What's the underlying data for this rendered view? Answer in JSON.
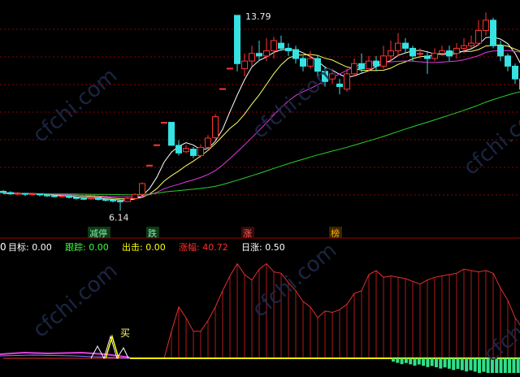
{
  "watermark": "cfchi.com",
  "main": {
    "price_high_label": "13.79",
    "price_low_label": "6.14",
    "markers": [
      {
        "text": "减停",
        "color": "#7cf0a8",
        "bg": "#0f3a18"
      },
      {
        "text": "跌",
        "color": "#7cf0a8",
        "bg": "#0f3a18"
      },
      {
        "text": "涨",
        "color": "#ff6060",
        "bg": "#3a0a0a"
      },
      {
        "text": "榜",
        "color": "#ffb000",
        "bg": "#3a2400"
      }
    ]
  },
  "indicator": {
    "prefix": "0",
    "items": [
      {
        "label": "目标",
        "value": "0.00",
        "color": "#ffffff"
      },
      {
        "label": "跟踪",
        "value": "0.00",
        "color": "#3cff3c"
      },
      {
        "label": "出击",
        "value": "0.00",
        "color": "#ffff00"
      },
      {
        "label": "涨幅",
        "value": "40.72",
        "color": "#ff3030"
      },
      {
        "label": "日涨",
        "value": "0.50",
        "color": "#ffffff"
      }
    ],
    "buy_label": "买"
  },
  "colors": {
    "up": "#ff3333",
    "down": "#36e2e2",
    "ma5": "#ffffff",
    "ma10": "#ffff66",
    "ma20": "#e03ce0",
    "ma60": "#2bd02b",
    "grid": "#8b0000"
  },
  "chart_data": {
    "type": "candlestick",
    "title": "",
    "ylim": [
      5.8,
      14.2
    ],
    "candles": [
      [
        6.9,
        6.85,
        6.95,
        6.8
      ],
      [
        6.85,
        6.8,
        6.9,
        6.75
      ],
      [
        6.8,
        6.82,
        6.86,
        6.74
      ],
      [
        6.82,
        6.78,
        6.84,
        6.72
      ],
      [
        6.78,
        6.8,
        6.84,
        6.74
      ],
      [
        6.8,
        6.76,
        6.82,
        6.7
      ],
      [
        6.76,
        6.72,
        6.78,
        6.68
      ],
      [
        6.72,
        6.7,
        6.76,
        6.66
      ],
      [
        6.7,
        6.72,
        6.75,
        6.66
      ],
      [
        6.72,
        6.66,
        6.74,
        6.62
      ],
      [
        6.66,
        6.62,
        6.68,
        6.58
      ],
      [
        6.62,
        6.6,
        6.66,
        6.55
      ],
      [
        6.6,
        6.64,
        6.68,
        6.56
      ],
      [
        6.64,
        6.58,
        6.66,
        6.54
      ],
      [
        6.58,
        6.56,
        6.62,
        6.5
      ],
      [
        6.56,
        6.52,
        6.58,
        6.46
      ],
      [
        6.52,
        6.5,
        6.55,
        6.14
      ],
      [
        6.5,
        6.62,
        6.66,
        6.48
      ],
      [
        6.62,
        6.78,
        6.82,
        6.58
      ],
      [
        6.78,
        7.2,
        7.25,
        6.74
      ],
      [
        7.9,
        7.92,
        7.94,
        7.88
      ],
      [
        8.7,
        8.72,
        8.74,
        8.68
      ],
      [
        9.58,
        9.6,
        9.62,
        9.56
      ],
      [
        9.6,
        8.7,
        9.6,
        8.68
      ],
      [
        8.7,
        8.4,
        8.9,
        8.3
      ],
      [
        8.45,
        8.58,
        8.72,
        8.4
      ],
      [
        8.55,
        8.3,
        8.64,
        8.2
      ],
      [
        8.3,
        8.62,
        8.74,
        8.22
      ],
      [
        8.62,
        8.98,
        9.1,
        8.55
      ],
      [
        9.0,
        9.82,
        9.92,
        8.9
      ],
      [
        10.9,
        10.92,
        10.94,
        10.88
      ],
      [
        11.7,
        11.72,
        11.74,
        11.68
      ],
      [
        13.79,
        11.9,
        13.79,
        11.6
      ],
      [
        11.7,
        12.0,
        12.3,
        11.4
      ],
      [
        12.0,
        12.3,
        12.6,
        11.8
      ],
      [
        12.3,
        12.2,
        12.8,
        12.0
      ],
      [
        12.2,
        12.4,
        12.9,
        12.0
      ],
      [
        12.4,
        12.8,
        12.95,
        12.1
      ],
      [
        12.7,
        12.5,
        13.0,
        12.4
      ],
      [
        12.5,
        12.4,
        12.7,
        12.2
      ],
      [
        12.45,
        12.1,
        12.6,
        11.9
      ],
      [
        12.1,
        11.8,
        12.2,
        11.6
      ],
      [
        11.8,
        12.1,
        12.4,
        11.7
      ],
      [
        12.1,
        11.6,
        12.2,
        11.4
      ],
      [
        11.6,
        11.2,
        11.8,
        11.0
      ],
      [
        11.3,
        11.5,
        11.7,
        11.1
      ],
      [
        11.1,
        11.0,
        11.3,
        10.7
      ],
      [
        10.9,
        11.5,
        11.7,
        10.8
      ],
      [
        11.5,
        11.9,
        12.1,
        11.4
      ],
      [
        11.9,
        11.7,
        12.3,
        11.5
      ],
      [
        11.7,
        12.0,
        12.2,
        11.6
      ],
      [
        12.0,
        11.8,
        12.2,
        11.6
      ],
      [
        11.8,
        12.2,
        12.6,
        11.7
      ],
      [
        12.2,
        12.4,
        12.8,
        12.0
      ],
      [
        12.4,
        12.7,
        13.1,
        12.2
      ],
      [
        12.7,
        12.5,
        12.9,
        12.3
      ],
      [
        12.5,
        12.2,
        12.6,
        12.0
      ],
      [
        12.3,
        12.3,
        12.5,
        12.1
      ],
      [
        12.2,
        12.1,
        12.4,
        11.5
      ],
      [
        12.1,
        12.3,
        12.5,
        12.0
      ],
      [
        12.3,
        12.4,
        12.6,
        12.2
      ],
      [
        12.4,
        12.2,
        12.6,
        12.0
      ],
      [
        12.3,
        12.5,
        12.7,
        12.1
      ],
      [
        12.5,
        12.6,
        12.9,
        12.3
      ],
      [
        12.6,
        12.7,
        13.0,
        12.5
      ],
      [
        12.7,
        13.2,
        13.6,
        12.6
      ],
      [
        13.2,
        13.6,
        13.9,
        13.0
      ],
      [
        13.6,
        12.6,
        13.7,
        12.5
      ],
      [
        12.6,
        12.2,
        12.8,
        12.0
      ],
      [
        12.2,
        11.8,
        12.3,
        11.6
      ],
      [
        11.8,
        11.3,
        11.9,
        11.1
      ],
      [
        11.3,
        10.9,
        11.4,
        10.7
      ]
    ],
    "indicator_line": [
      0,
      0,
      0,
      0,
      0,
      0,
      0,
      0,
      0,
      0,
      0,
      0,
      0,
      0,
      0,
      0,
      0,
      0,
      0,
      0,
      0,
      0,
      0,
      2.0,
      3.8,
      3.0,
      2.0,
      2.0,
      2.8,
      3.8,
      5.0,
      6.1,
      7.0,
      6.2,
      5.8,
      6.6,
      7.0,
      6.4,
      6.3,
      5.6,
      5.0,
      4.2,
      3.8,
      3.0,
      3.5,
      3.4,
      3.6,
      4.0,
      4.8,
      5.0,
      6.2,
      6.5,
      6.0,
      6.1,
      6.0,
      5.9,
      5.7,
      5.5,
      5.8,
      6.0,
      6.1,
      6.2,
      6.3,
      6.6,
      6.5,
      6.4,
      6.5,
      6.3,
      5.2,
      4.3,
      3.0,
      2.2
    ]
  }
}
